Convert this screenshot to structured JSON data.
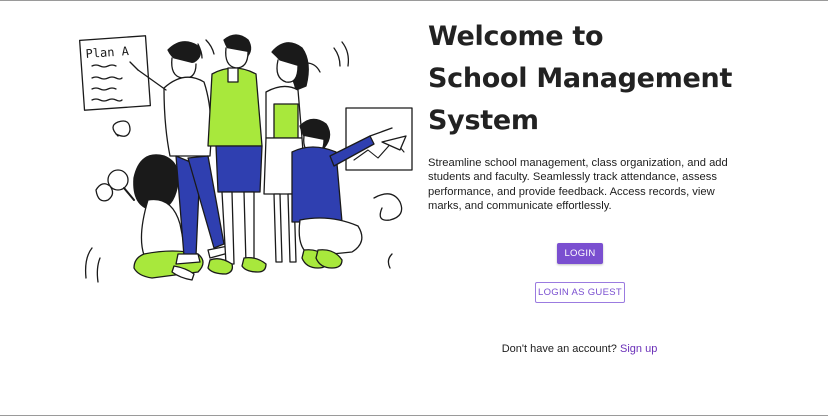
{
  "hero": {
    "title_lines": [
      "Welcome to",
      "School Management",
      "System"
    ],
    "description": "Streamline school management, class organization, and add students and faculty. Seamlessly track attendance, assess performance, and provide feedback. Access records, view marks, and communicate effortlessly."
  },
  "illustration": {
    "board_text": "Plan A",
    "colors": {
      "lime": "#a8e83c",
      "blue": "#2f3fb0",
      "ink": "#1a1a1a"
    }
  },
  "actions": {
    "login_label": "LOGIN",
    "guest_label": "LOGIN AS GUEST"
  },
  "signup": {
    "prompt": "Don't have an account?",
    "link_label": "Sign up"
  },
  "colors": {
    "accent": "#7a4fd0",
    "link": "#6a2fb8"
  }
}
